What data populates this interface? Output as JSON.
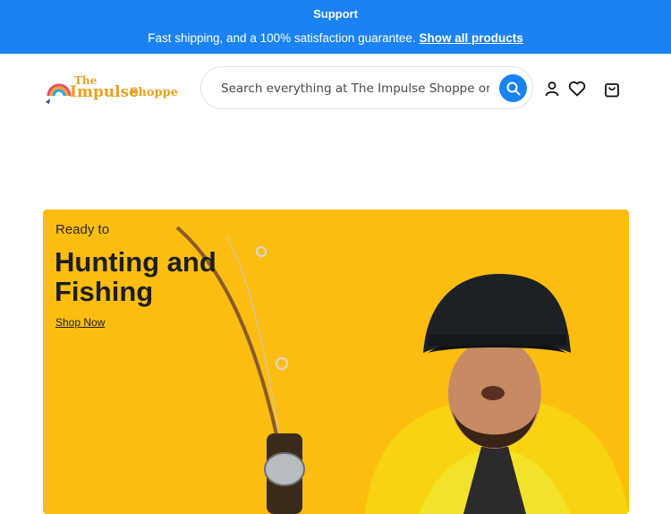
{
  "announcement": {
    "support": "Support",
    "shipping_text": "Fast shipping, and a 100% satisfaction guarantee.",
    "shipping_link": "Show all products",
    "bg_color": "#1a82f5"
  },
  "header": {
    "logo": {
      "the": "The",
      "impulse": "Impulse",
      "shoppe": "Shoppe"
    },
    "search": {
      "placeholder": "Search everything at The Impulse Shoppe online and in store"
    },
    "icons": [
      "search-icon",
      "account-icon",
      "wishlist-heart-icon",
      "cart-bag-icon"
    ]
  },
  "hero": {
    "pretitle": "Ready to",
    "title": "Hunting and Fishing",
    "cta": "Shop Now",
    "bg_color": "#fdbd10"
  }
}
